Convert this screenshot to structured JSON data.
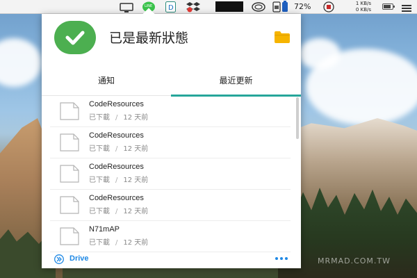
{
  "menubar": {
    "icons": [
      "display-icon",
      "line-icon",
      "dashlane-icon",
      "dropbox-icon",
      "black-window-icon",
      "creative-cloud-icon",
      "sim-card-icon",
      "battery-status-icon",
      "network-meter-icon",
      "battery-icon"
    ],
    "line_label": "LINE",
    "temperature": "72%",
    "net_up": "1 KB/s",
    "net_down": "0 KB/s"
  },
  "panel": {
    "status_title": "已是最新狀態",
    "tabs": [
      {
        "label": "通知",
        "active": false
      },
      {
        "label": "最近更新",
        "active": true
      }
    ],
    "files": [
      {
        "name": "CodeResources",
        "status": "已下載",
        "time": "12 天前"
      },
      {
        "name": "CodeResources",
        "status": "已下載",
        "time": "12 天前"
      },
      {
        "name": "CodeResources",
        "status": "已下載",
        "time": "12 天前"
      },
      {
        "name": "CodeResources",
        "status": "已下載",
        "time": "12 天前"
      },
      {
        "name": "N71mAP",
        "status": "已下載",
        "time": "12 天前"
      }
    ],
    "meta_separator": "/",
    "footer_link": "Drive"
  },
  "colors": {
    "accent_green": "#4caf50",
    "tab_underline": "#26a69a",
    "link_blue": "#1e88e5",
    "folder_yellow": "#f6b400"
  },
  "watermark": "MRMAD.COM.TW"
}
